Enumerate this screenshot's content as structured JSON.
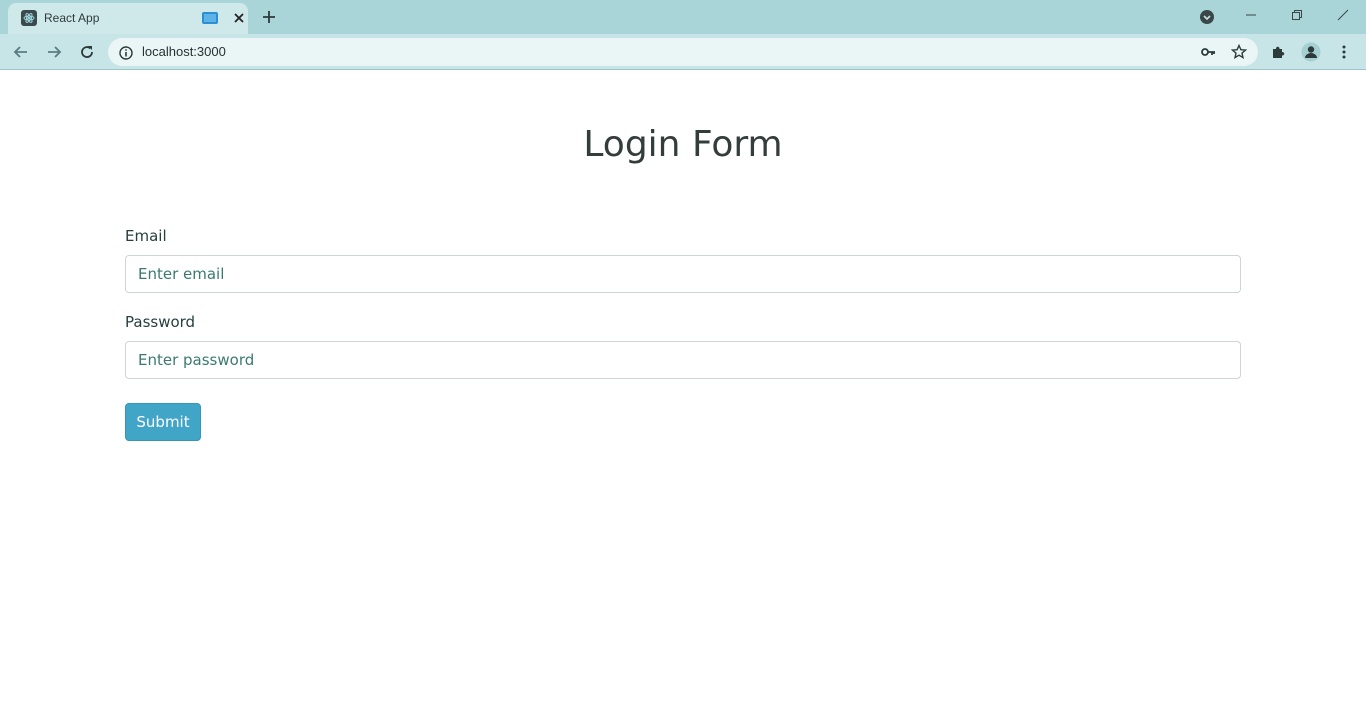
{
  "browser": {
    "tab_title": "React App",
    "url": "localhost:3000"
  },
  "page": {
    "title": "Login Form",
    "email": {
      "label": "Email",
      "placeholder": "Enter email",
      "value": ""
    },
    "password": {
      "label": "Password",
      "placeholder": "Enter password",
      "value": ""
    },
    "submit_label": "Submit"
  },
  "colors": {
    "chrome_tabstrip": "#a9d4d8",
    "chrome_toolbar": "#c7e4e6",
    "submit_button": "#41a5c8",
    "heading_text": "#333d3c"
  },
  "icons": {
    "tab": [
      "react-favicon-icon",
      "media-playing-icon",
      "close-icon",
      "plus-icon"
    ],
    "toolbar": [
      "back-arrow-icon",
      "forward-arrow-icon",
      "reload-icon",
      "info-icon",
      "key-icon",
      "star-icon",
      "puzzle-icon",
      "profile-icon",
      "kebab-menu-icon"
    ]
  }
}
